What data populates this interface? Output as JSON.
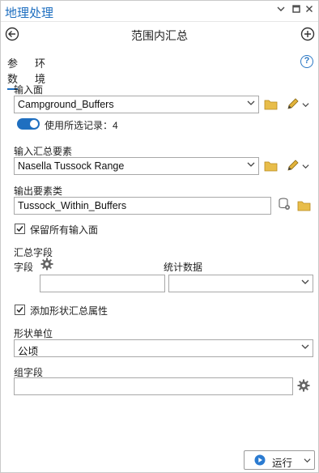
{
  "window": {
    "title": "地理处理"
  },
  "tool": {
    "title": "范围内汇总"
  },
  "tabs": [
    {
      "label": "参数",
      "active": true
    },
    {
      "label": "环境",
      "active": false
    }
  ],
  "params": {
    "input_polygons": {
      "label": "输入面",
      "value": "Campground_Buffers"
    },
    "use_selected": {
      "label": "使用所选记录：4",
      "on": true
    },
    "input_summary": {
      "label": "输入汇总要素",
      "value": "Nasella Tussock Range"
    },
    "output": {
      "label": "输出要素类",
      "value": "Tussock_Within_Buffers"
    },
    "keep_all": {
      "label": "保留所有输入面",
      "checked": true
    },
    "summary_fields": {
      "label": "汇总字段",
      "field_label": "字段",
      "stat_label": "统计数据",
      "field_value": "",
      "stat_value": ""
    },
    "add_shape": {
      "label": "添加形状汇总属性",
      "checked": true
    },
    "shape_unit": {
      "label": "形状单位",
      "value": "公顷"
    },
    "group_field": {
      "label": "组字段",
      "value": ""
    }
  },
  "run": {
    "label": "运行"
  },
  "colors": {
    "accent": "#1f6fc0",
    "folder": "#e2b33b"
  },
  "icons": [
    "back-icon",
    "add-icon",
    "help-icon",
    "folder-icon",
    "pencil-icon",
    "gear-icon",
    "chevron-down-icon",
    "play-icon"
  ]
}
